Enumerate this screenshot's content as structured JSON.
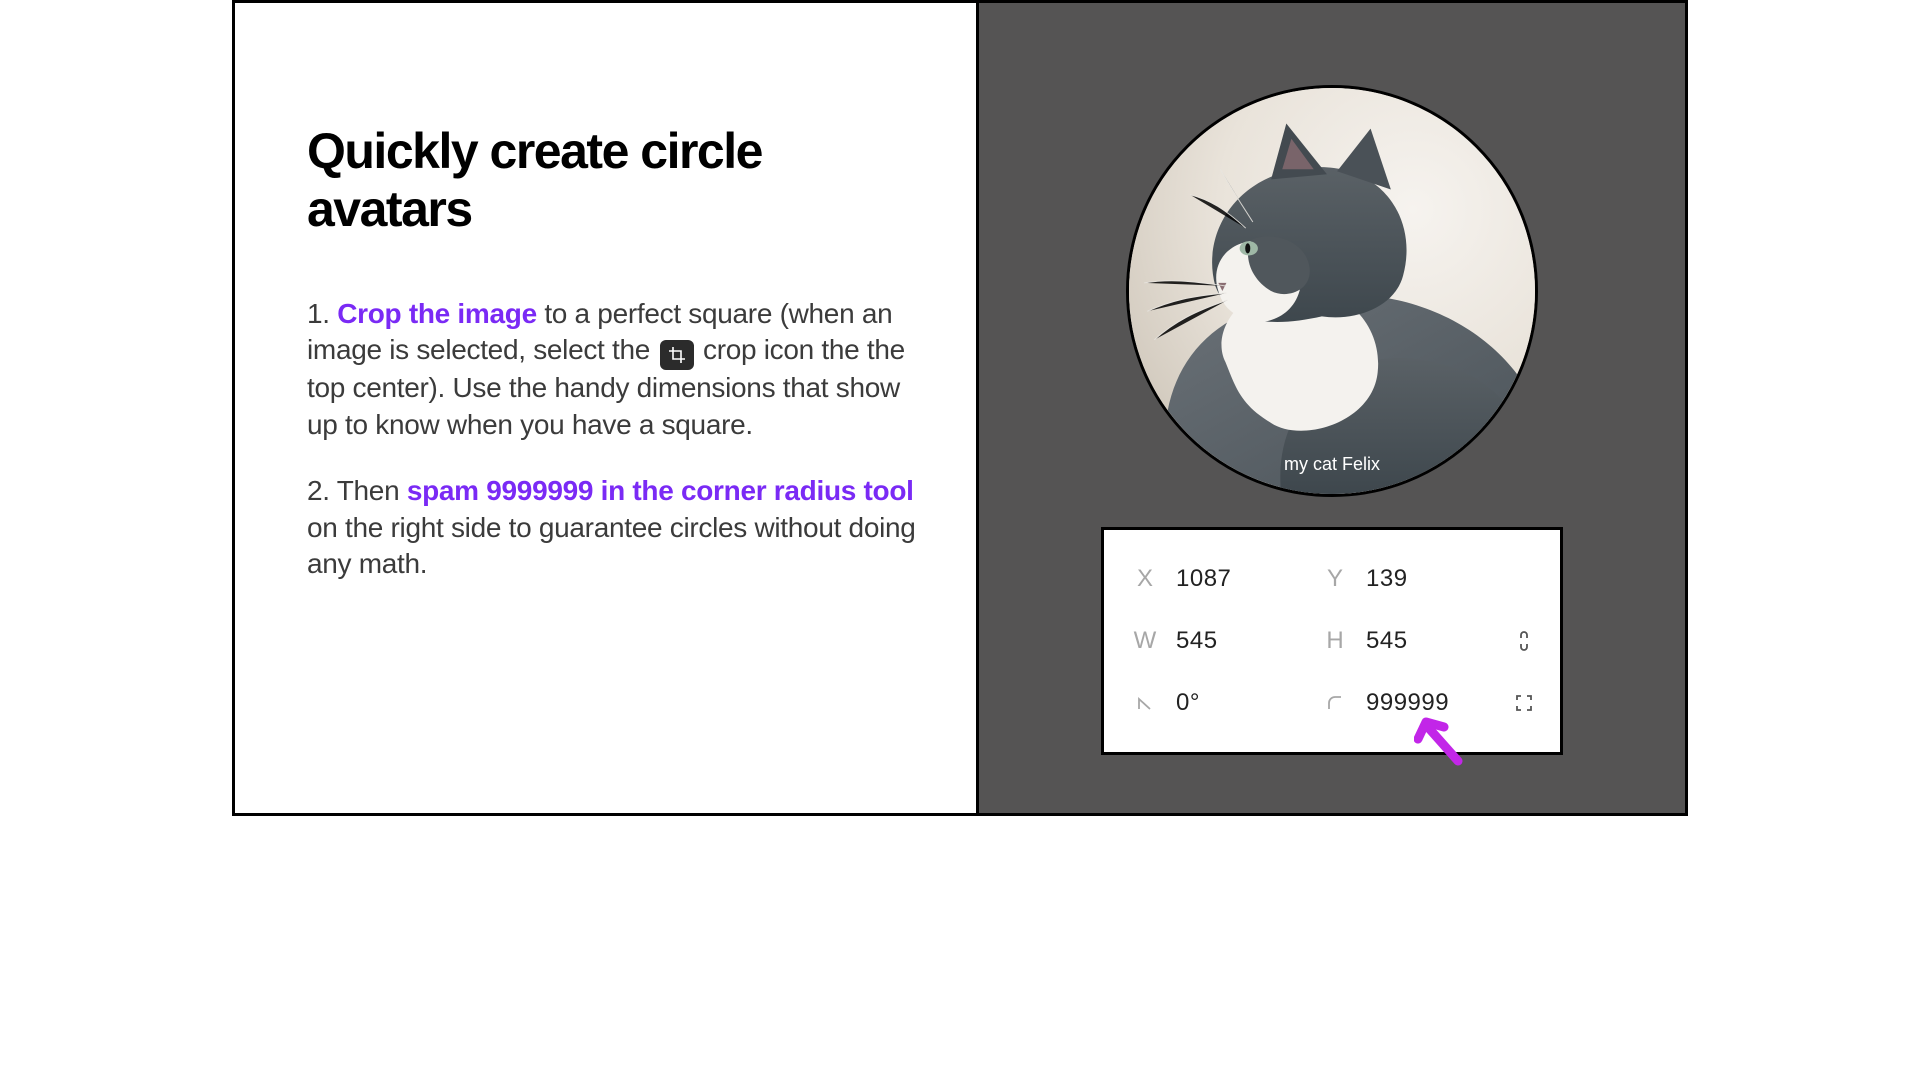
{
  "left": {
    "title": "Quickly create circle avatars",
    "step1": {
      "num": "1. ",
      "hl": "Crop the image",
      "rest_a": " to a perfect square (when an image is selected, select the ",
      "rest_b": " crop icon the the top center). Use the handy dimensions that show up to know when you have a square."
    },
    "step2": {
      "num": "2. Then ",
      "hl": "spam 9999999 in the corner radius tool",
      "rest": " on the right side to guarantee circles without doing any math."
    }
  },
  "right": {
    "caption": "my cat Felix",
    "panel": {
      "x_label": "X",
      "x_val": "1087",
      "y_label": "Y",
      "y_val": "139",
      "w_label": "W",
      "w_val": "545",
      "h_label": "H",
      "h_val": "545",
      "rot_val": "0°",
      "radius_val": "999999"
    }
  }
}
